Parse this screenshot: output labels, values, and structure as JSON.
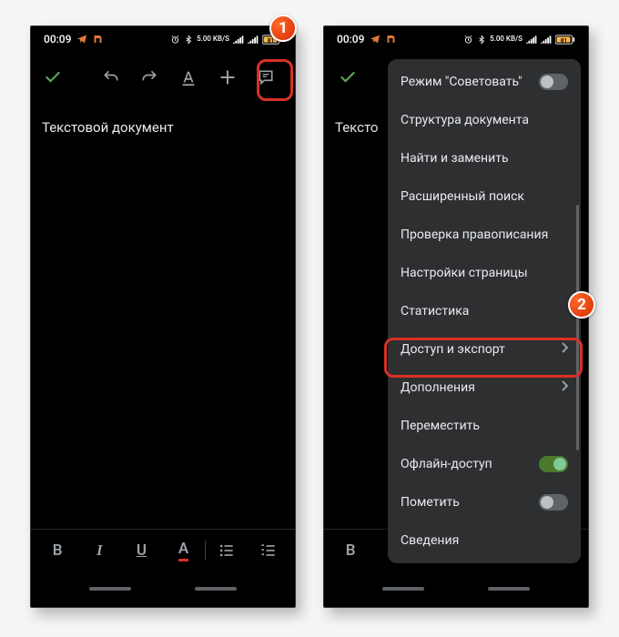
{
  "statusbar": {
    "time": "00:09",
    "net_text": "5.00 KB/S"
  },
  "toolbar": {
    "check": "✓",
    "undo": "↶",
    "redo": "↷",
    "text_format": "A",
    "add": "+",
    "comment": "▤",
    "more": "⋮"
  },
  "document": {
    "title_text": "Текстовой документ",
    "title_text_truncated": "Тексто"
  },
  "bottombar": {
    "bold": "B",
    "italic": "I",
    "underline": "U",
    "color": "A",
    "bullets": "≡",
    "numbered": "≡"
  },
  "menu": {
    "items": [
      {
        "label": "Режим \"Советовать\"",
        "type": "toggle",
        "on": false
      },
      {
        "label": "Структура документа",
        "type": "plain"
      },
      {
        "label": "Найти и заменить",
        "type": "plain"
      },
      {
        "label": "Расширенный поиск",
        "type": "plain"
      },
      {
        "label": "Проверка правописания",
        "type": "plain"
      },
      {
        "label": "Настройки страницы",
        "type": "plain"
      },
      {
        "label": "Статистика",
        "type": "plain"
      },
      {
        "label": "Доступ и экспорт",
        "type": "submenu"
      },
      {
        "label": "Дополнения",
        "type": "submenu"
      },
      {
        "label": "Переместить",
        "type": "plain"
      },
      {
        "label": "Офлайн-доступ",
        "type": "toggle",
        "on": true
      },
      {
        "label": "Пометить",
        "type": "toggle",
        "on": false
      },
      {
        "label": "Сведения",
        "type": "plain"
      }
    ]
  },
  "callouts": {
    "one": "1",
    "two": "2"
  },
  "colors": {
    "highlight": "#d93025",
    "toggle_on": "#81c995"
  }
}
